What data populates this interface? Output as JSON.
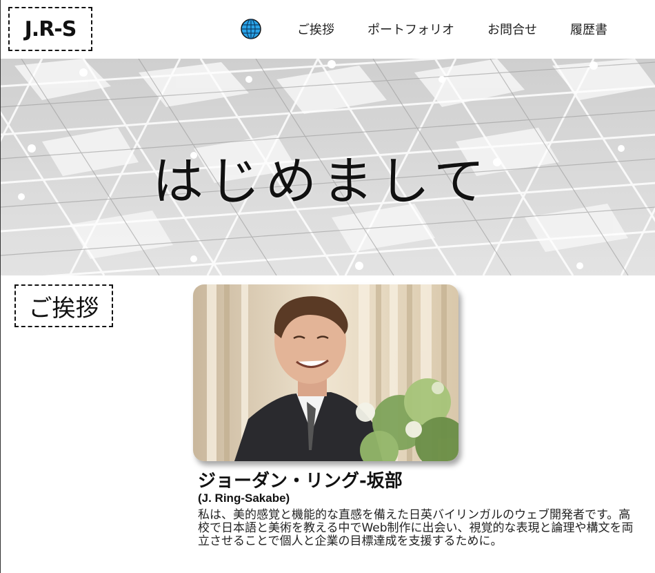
{
  "header": {
    "logo_text": "J.R-S",
    "nav": [
      {
        "label": "ご挨拶"
      },
      {
        "label": "ポートフォリオ"
      },
      {
        "label": "お問合せ"
      },
      {
        "label": "履歴書"
      }
    ],
    "language_icon": "globe-icon"
  },
  "hero": {
    "title": "はじめまして"
  },
  "greeting": {
    "section_label": "ご挨拶",
    "name": "ジョーダン・リング-坂部",
    "romaji": "(J. Ring-Sakabe)",
    "bio": "私は、美的感覚と機能的な直感を備えた日英バイリンガルのウェブ開発者です。高校で日本語と美術を教える中でWeb制作に出会い、視覚的な表現と論理や構文を両立させることで個人と企業の目標達成を支援するために。"
  },
  "colors": {
    "accent_globe": "#2aa3e8",
    "text": "#111111",
    "hero_bg": "#d9d9d9"
  }
}
